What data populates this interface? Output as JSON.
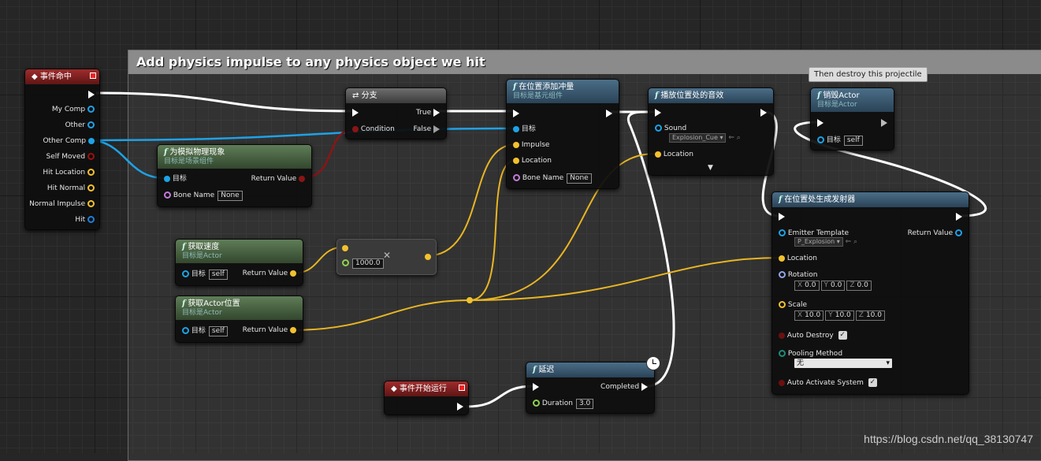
{
  "comment": {
    "title": "Add physics impulse to any physics object we hit"
  },
  "tooltip": "Then destroy this projectile",
  "nodes": {
    "hit_event": {
      "title": "事件命中",
      "pins": [
        "My Comp",
        "Other",
        "Other Comp",
        "Self Moved",
        "Hit Location",
        "Hit Normal",
        "Normal Impulse",
        "Hit"
      ]
    },
    "branch": {
      "title": "分支",
      "condition": "Condition",
      "true": "True",
      "false": "False"
    },
    "simulate": {
      "title": "为模拟物理现象",
      "subtitle": "目标是场景组件",
      "target": "目标",
      "bone": "Bone Name",
      "bone_val": "None",
      "ret": "Return Value"
    },
    "add_impulse": {
      "title": "在位置添加冲量",
      "subtitle": "目标是基元组件",
      "target": "目标",
      "impulse": "Impulse",
      "location": "Location",
      "bone": "Bone Name",
      "bone_val": "None"
    },
    "play_sound": {
      "title": "播放位置处的音效",
      "sound": "Sound",
      "sound_val": "Explosion_Cue",
      "location": "Location"
    },
    "destroy": {
      "title": "销毁Actor",
      "subtitle": "目标是Actor",
      "target": "目标",
      "target_val": "self"
    },
    "spawn": {
      "title": "在位置处生成发射器",
      "template": "Emitter Template",
      "template_val": "P_Explosion",
      "ret": "Return Value",
      "location": "Location",
      "rotation": "Rotation",
      "rot": {
        "x": "0.0",
        "y": "0.0",
        "z": "0.0"
      },
      "scale": "Scale",
      "scl": {
        "x": "10.0",
        "y": "10.0",
        "z": "10.0"
      },
      "auto_destroy": "Auto Destroy",
      "pooling": "Pooling Method",
      "pooling_val": "无",
      "auto_activate": "Auto Activate System"
    },
    "velocity": {
      "title": "获取速度",
      "subtitle": "目标是Actor",
      "target": "目标",
      "target_val": "self",
      "ret": "Return Value"
    },
    "multiply": {
      "value": "1000.0"
    },
    "location": {
      "title": "获取Actor位置",
      "subtitle": "目标是Actor",
      "target": "目标",
      "target_val": "self",
      "ret": "Return Value"
    },
    "begin_play": {
      "title": "事件开始运行"
    },
    "delay": {
      "title": "延迟",
      "completed": "Completed",
      "duration": "Duration",
      "duration_val": "3.0"
    }
  },
  "axis_labels": {
    "x": "X",
    "y": "Y",
    "z": "Z"
  },
  "watermark": "https://blog.csdn.net/qq_38130747",
  "colors": {
    "exec": "#ffffff",
    "object": "#1ea2e6",
    "vector": "#f2c12e",
    "bool": "#9a1010",
    "name": "#c37bd8",
    "float": "#8fd14f",
    "struct": "#7dd"
  }
}
